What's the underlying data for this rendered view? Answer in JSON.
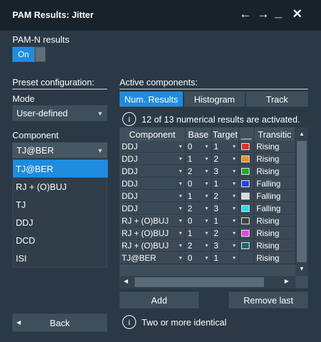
{
  "window": {
    "title": "PAM Results: Jitter",
    "icons": [
      "arrow-left-icon",
      "arrow-right-icon",
      "minimize-icon",
      "close-icon"
    ]
  },
  "pam": {
    "label": "PAM-N results",
    "toggle_label": "On",
    "toggle_state": true
  },
  "preset": {
    "label": "Preset configuration:"
  },
  "mode": {
    "label": "Mode",
    "value": "User-defined"
  },
  "component": {
    "label": "Component",
    "value": "TJ@BER",
    "options": [
      "TJ@BER",
      "RJ + (O)BUJ",
      "TJ",
      "DDJ",
      "DCD",
      "ISI"
    ],
    "selected_index": 0
  },
  "active": {
    "label": "Active components:",
    "tabs": [
      "Num. Results",
      "Histogram",
      "Track"
    ],
    "active_tab": 0,
    "info_text": "12 of 13 numerical results are activated.",
    "columns": [
      "Component",
      "Base",
      "Target",
      "__",
      "Transitic"
    ],
    "rows": [
      {
        "component": "DDJ",
        "base": "0",
        "target": "1",
        "color": "#e52b2b",
        "transition": "Rising"
      },
      {
        "component": "DDJ",
        "base": "1",
        "target": "2",
        "color": "#f0901a",
        "transition": "Rising"
      },
      {
        "component": "DDJ",
        "base": "2",
        "target": "3",
        "color": "#1faa2b",
        "transition": "Rising"
      },
      {
        "component": "DDJ",
        "base": "0",
        "target": "1",
        "color": "#2246e0",
        "transition": "Falling"
      },
      {
        "component": "DDJ",
        "base": "1",
        "target": "2",
        "color": "#d8d8d8",
        "transition": "Falling"
      },
      {
        "component": "DDJ",
        "base": "2",
        "target": "3",
        "color": "#22e0e8",
        "transition": "Falling"
      },
      {
        "component": "RJ + (O)BUJ",
        "base": "0",
        "target": "1",
        "color": "#404040",
        "transition": "Rising"
      },
      {
        "component": "RJ + (O)BUJ",
        "base": "1",
        "target": "2",
        "color": "#e845e0",
        "transition": "Rising"
      },
      {
        "component": "RJ + (O)BUJ",
        "base": "2",
        "target": "3",
        "color": "#136b6b",
        "transition": "Rising"
      },
      {
        "component": "TJ@BER",
        "base": "0",
        "target": "1",
        "color": "",
        "transition": "Rising"
      }
    ]
  },
  "buttons": {
    "add": "Add",
    "remove_last": "Remove last",
    "back": "Back"
  },
  "status": {
    "text": "Two or more identical"
  },
  "colors": {
    "accent": "#1f8ce0",
    "background": "#2a3945",
    "titlebar": "#17222b"
  }
}
